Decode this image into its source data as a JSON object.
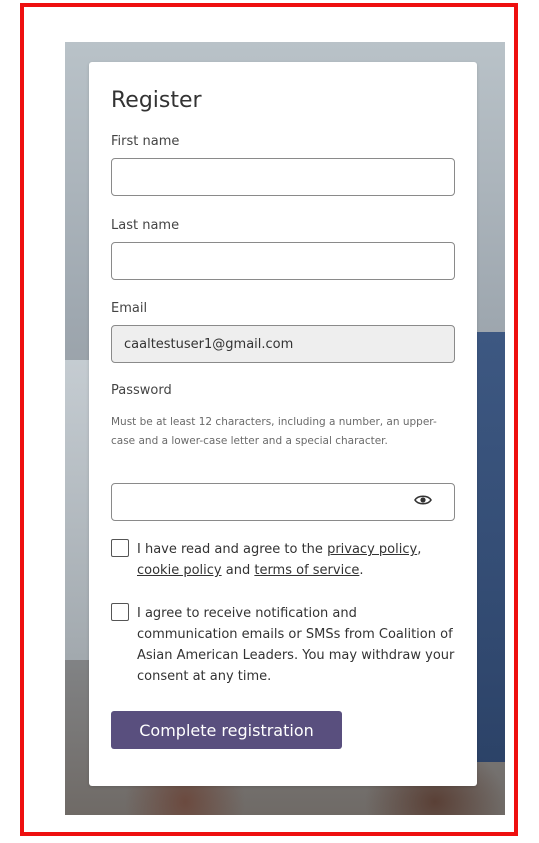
{
  "form": {
    "title": "Register",
    "first_name": {
      "label": "First name",
      "value": ""
    },
    "last_name": {
      "label": "Last name",
      "value": ""
    },
    "email": {
      "label": "Email",
      "value": "caaltestuser1@gmail.com"
    },
    "password": {
      "label": "Password",
      "hint": "Must be at least 12 characters, including a number, an upper-case and a lower-case letter and a special character.",
      "value": ""
    },
    "consent_terms": {
      "prefix": "I have read and agree to the ",
      "privacy_link": "privacy policy",
      "comma": ",",
      "cookie_link": "cookie policy",
      "and": " and ",
      "terms_link": "terms of service",
      "suffix": "."
    },
    "consent_notifications": "I agree to receive notification and communication emails or SMSs from Coalition of Asian American Leaders. You may withdraw your consent at any time.",
    "submit_label": "Complete registration"
  },
  "colors": {
    "accent_button": "#594f7e",
    "frame_border": "#ee1010"
  },
  "icons": {
    "password_toggle": "eye-icon"
  }
}
